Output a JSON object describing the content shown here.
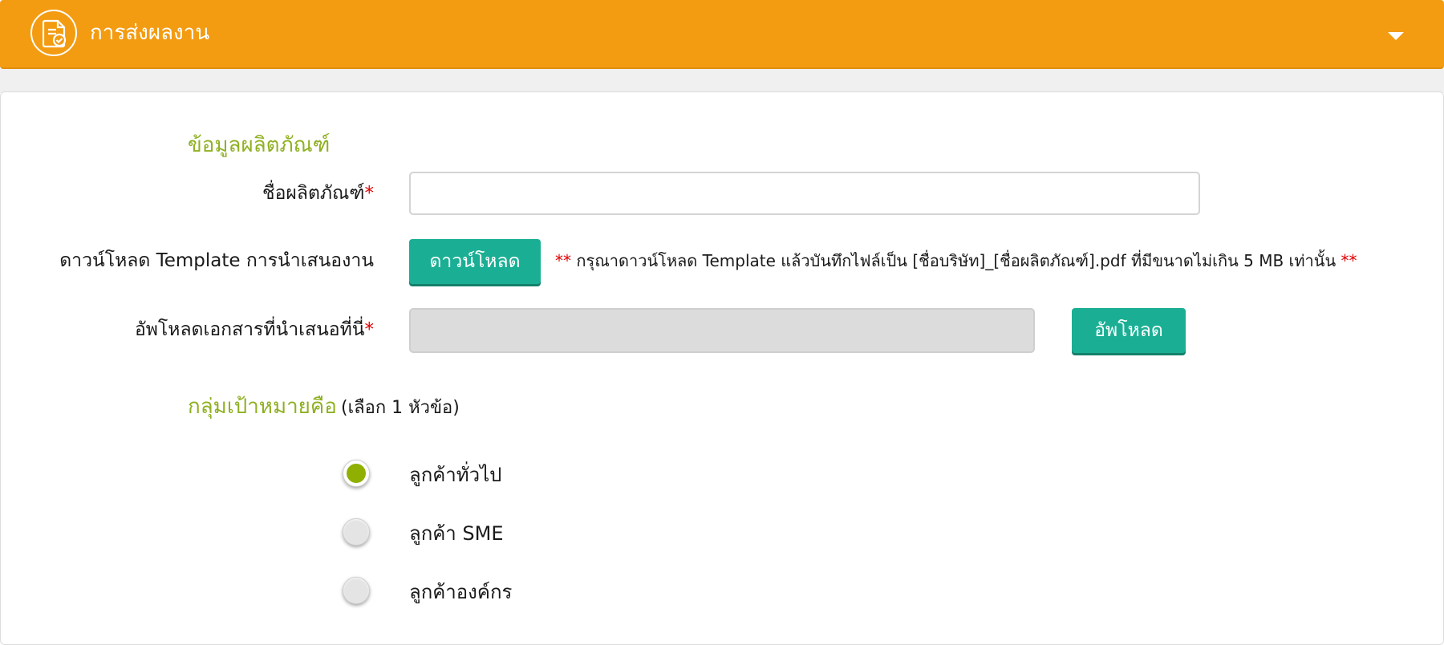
{
  "header": {
    "title": "การส่งผลงาน",
    "icon": "document-check-icon",
    "collapse_icon": "caret-down-icon",
    "color": "#f39c12"
  },
  "product_section": {
    "title": "ข้อมูลผลิตภัณฑ์",
    "product_name_label": "ชื่อผลิตภัณฑ์",
    "product_name_value": "",
    "template_label": "ดาวน์โหลด Template การนำเสนองาน",
    "download_button": "ดาวน์โหลด",
    "download_note_prefix": "**",
    "download_note": " กรุณาดาวน์โหลด Template แล้วบันทึกไฟล์เป็น [ชื่อบริษัท]_[ชื่อผลิตภัณฑ์].pdf ที่มีขนาดไม่เกิน 5 MB เท่านั้น ",
    "download_note_suffix": "**",
    "upload_label": "อัพโหลดเอกสารที่นำเสนอที่นี่",
    "upload_value": "",
    "upload_button": "อัพโหลด",
    "required_mark": "*",
    "button_color": "#1aaf94"
  },
  "target_section": {
    "title": "กลุ่มเป้าหมายคือ",
    "hint": "(เลือก 1 หัวข้อ)",
    "options": [
      {
        "label": "ลูกค้าทั่วไป",
        "checked": true
      },
      {
        "label": "ลูกค้า SME",
        "checked": false
      },
      {
        "label": "ลูกค้าองค์กร",
        "checked": false
      }
    ]
  }
}
